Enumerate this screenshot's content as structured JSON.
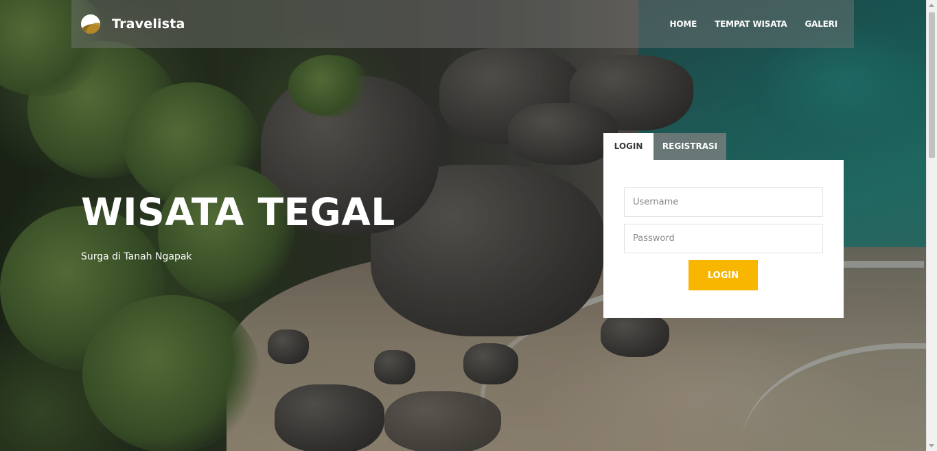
{
  "brand": {
    "name": "Travelista"
  },
  "nav": {
    "items": [
      "HOME",
      "TEMPAT WISATA",
      "GALERI"
    ]
  },
  "hero": {
    "title": "WISATA TEGAL",
    "subtitle": "Surga di Tanah Ngapak"
  },
  "login_panel": {
    "tabs": [
      {
        "label": "LOGIN",
        "active": true
      },
      {
        "label": "REGISTRASI",
        "active": false
      }
    ],
    "username_placeholder": "Username",
    "password_placeholder": "Password",
    "submit_label": "LOGIN"
  },
  "colors": {
    "accent": "#f8b600",
    "navbar_bg": "rgba(120,120,118,0.45)",
    "panel_bg": "#ffffff",
    "tab_inactive_bg": "rgba(130,130,130,0.75)"
  },
  "icons": {
    "brand_logo": "travelista-logo-icon"
  }
}
